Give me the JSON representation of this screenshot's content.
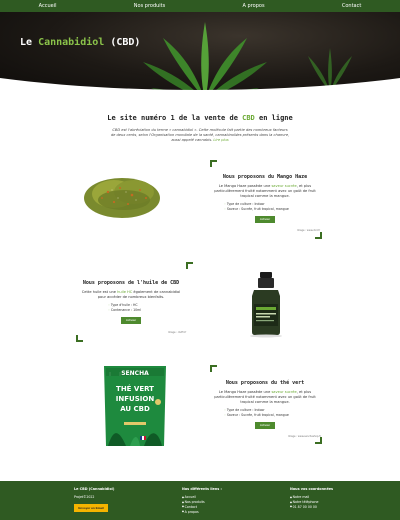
{
  "nav": {
    "items": [
      "Accueil",
      "Nos produits",
      "A propos",
      "Contact"
    ]
  },
  "hero": {
    "title_prefix": "Le ",
    "title_accent": "Cannabidiol",
    "title_suffix": " (CBD)"
  },
  "intro": {
    "heading_prefix": "Le site numéro 1 de la vente de ",
    "heading_accent": "CBD",
    "heading_suffix": " en ligne",
    "paragraph": "CBD est l'abréviation du terme « cannabidiol ». Cette molécule fait partie des nombreux facteurs de deux cents, selon l'Organisation mondiale de la santé, cannabinoïdes présents dans la chanvre, aussi appelé cannabis.",
    "paragraph_link": "Lire plus"
  },
  "products": [
    {
      "title": "Nous proposons du Mango Haze",
      "text_prefix": "Le Mango Haze possède une ",
      "text_accent": "saveur sucrée",
      "text_suffix": ", et plus particulièrement fruité notamment avec un goût de fruit tropical comme la mangue.",
      "list": [
        "Type de culture : Indoor",
        "Saveur : Sucrée, fruit tropical, mangue"
      ],
      "button": "Acheter",
      "credit": "Image : www.cbd.fr"
    },
    {
      "title": "Nous proposons de l'huile de CBD",
      "text_prefix": "Cette huile est une ",
      "text_accent": "huile HC",
      "text_suffix": " également de cannabidiol pour accéder de nombreux bienfaits.",
      "list": [
        "Type d'huile : HC",
        "Contenance : 10ml"
      ],
      "button": "Acheter",
      "credit": "Image : cbdfr.fr"
    },
    {
      "title": "Nous proposons du thé vert",
      "text_prefix": "Le Mango Haze possède une ",
      "text_accent": "saveur sucrée",
      "text_suffix": ", et plus particulièrement fruité notamment avec un goût de fruit tropical comme la mangue.",
      "list": [
        "Type de culture : Indoor",
        "Saveur : Sucrée, fruit tropical, mangue"
      ],
      "button": "Acheter",
      "credit": "Image : www.senchashop.fr"
    }
  ],
  "tea_bag": {
    "brand": "SENCHA",
    "line1": "THÉ VERT",
    "line2": "INFUSION",
    "line3": "AU CBD"
  },
  "footer": {
    "col1_title": "Le CBD (Cannabidiol)",
    "col1_sub": "Projet©2022",
    "col1_button": "Envoyer un Email",
    "col2_title": "Nos différents liens :",
    "col2_links": [
      "Accueil",
      "Nos produits",
      "Contact",
      "A propos"
    ],
    "col3_title": "Nous vos coordonnées",
    "col3_lines": [
      "Notre mail",
      "Notre téléphone",
      "01 87 00 00 00"
    ]
  }
}
